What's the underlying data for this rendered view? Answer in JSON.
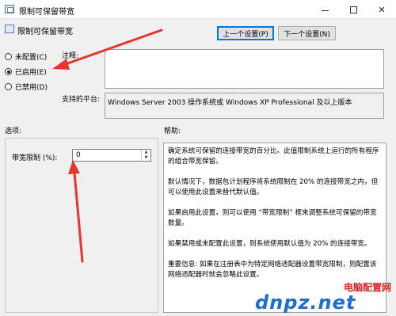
{
  "window": {
    "title": "限制可保留带宽",
    "icon": "policy-icon"
  },
  "header": {
    "title": "限制可保留带宽"
  },
  "nav": {
    "prev_label": "上一个设置(P)",
    "next_label": "下一个设置(N)"
  },
  "state_options": [
    {
      "label": "未配置(C)",
      "checked": false
    },
    {
      "label": "已启用(E)",
      "checked": true
    },
    {
      "label": "已禁用(D)",
      "checked": false
    }
  ],
  "comment": {
    "label": "注释:",
    "value": ""
  },
  "platform": {
    "label": "支持的平台:",
    "value": "Windows Server 2003 操作系统或 Windows XP Professional 及以上版本"
  },
  "options": {
    "label": "选项:",
    "bandwidth_limit_label": "带宽限制 (%):",
    "bandwidth_limit_value": "0"
  },
  "help": {
    "label": "帮助:",
    "paragraphs": [
      "确定系统可保留的连接带宽的百分比。此值限制系统上运行的所有程序的组合带宽保留。",
      "默认情况下，数据包计划程序将系统限制在 20% 的连接带宽之内，但可以使用此设置来替代默认值。",
      "如果启用此设置，则可以使用 “带宽限制” 框来调整系统可保留的带宽数量。",
      "如果禁用或未配置此设置，则系统使用默认值为 20% 的连接带宽。",
      "重要信息: 如果在注册表中为特定网络适配器设置带宽限制，则配置该网络适配器时就会忽略此设置。"
    ]
  },
  "watermark": {
    "main": "dnpz.net",
    "sub": "电脑配置网"
  },
  "colors": {
    "annotation_arrow": "#e8352b",
    "watermark_blue": "#1c6ed4",
    "watermark_red": "#e02020"
  }
}
